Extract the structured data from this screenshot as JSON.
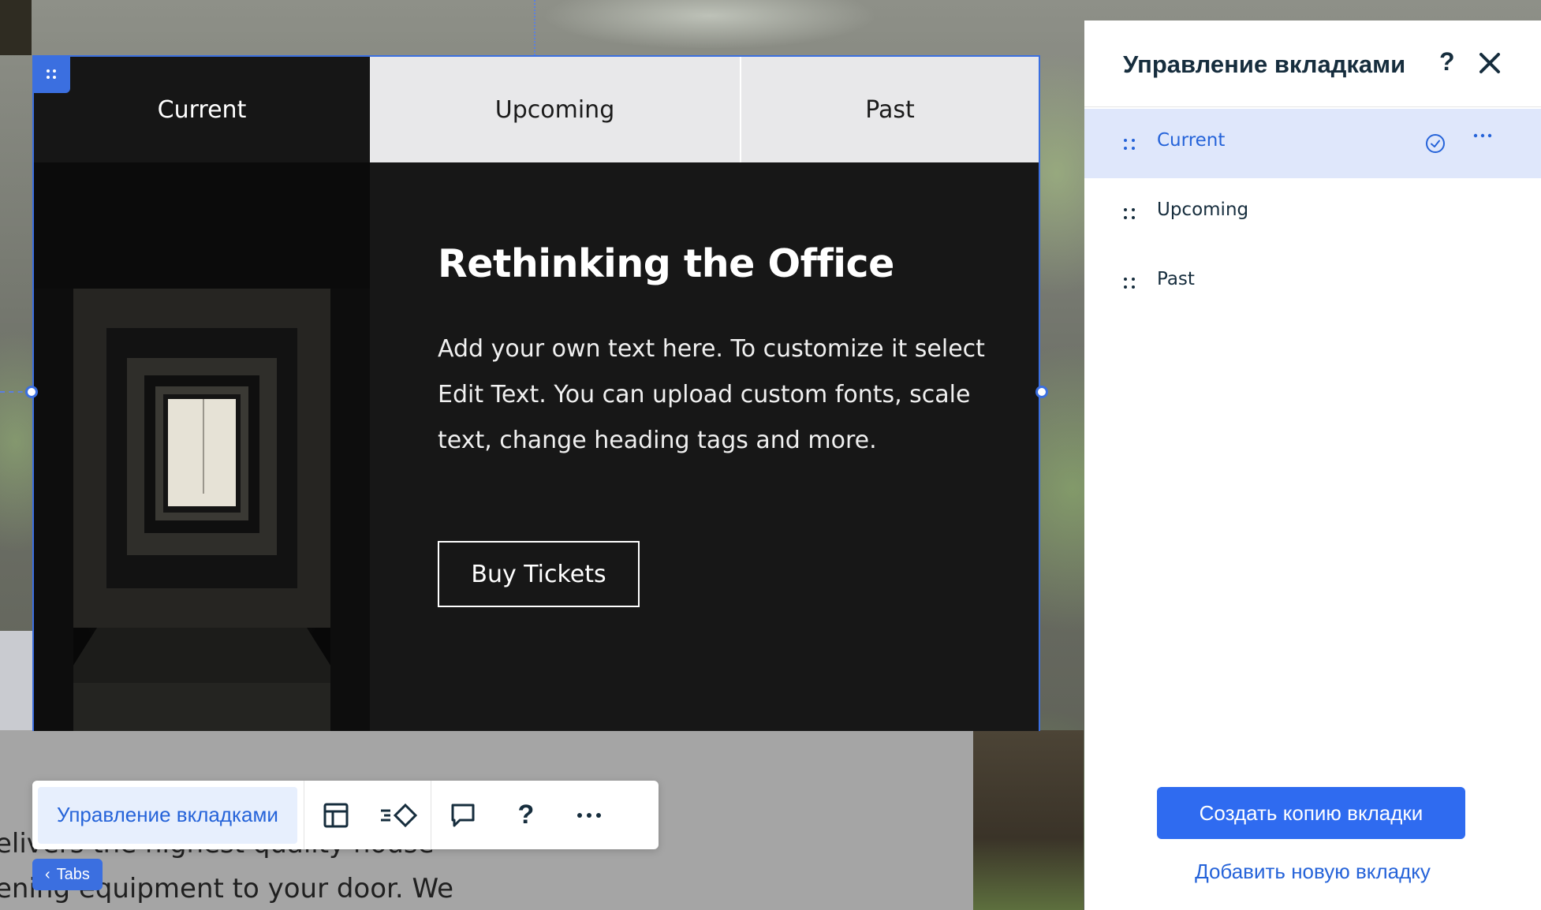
{
  "tabs_widget": {
    "tabs": [
      {
        "label": "Current",
        "active": true
      },
      {
        "label": "Upcoming",
        "active": false
      },
      {
        "label": "Past",
        "active": false
      }
    ],
    "content": {
      "heading": "Rethinking the Office",
      "paragraph": "Add your own text here. To customize it select Edit Text. You can upload custom fonts, scale text, change heading tags and more.",
      "button_label": "Buy Tickets"
    }
  },
  "background_text": {
    "line1": "elivers the highest quality house",
    "line2": "ening equipment to your door. We"
  },
  "toolbar": {
    "manage_label": "Управление вкладками",
    "icons": [
      "layout-icon",
      "animation-icon",
      "comment-icon",
      "help-icon",
      "more-icon"
    ],
    "help_glyph": "?"
  },
  "breadcrumb_chip": {
    "label": "Tabs",
    "chevron": "‹"
  },
  "side_panel": {
    "title": "Управление вкладками",
    "help_glyph": "?",
    "items": [
      {
        "label": "Current",
        "selected": true
      },
      {
        "label": "Upcoming",
        "selected": false
      },
      {
        "label": "Past",
        "selected": false
      }
    ],
    "duplicate_button": "Создать копию вкладки",
    "add_link": "Добавить новую вкладку"
  },
  "colors": {
    "accent": "#3b6fe0",
    "primary_button": "#2f6bf0",
    "selected_row": "#dfe7fb",
    "tab_dark": "#161616",
    "tab_light": "#e8e8ea"
  }
}
